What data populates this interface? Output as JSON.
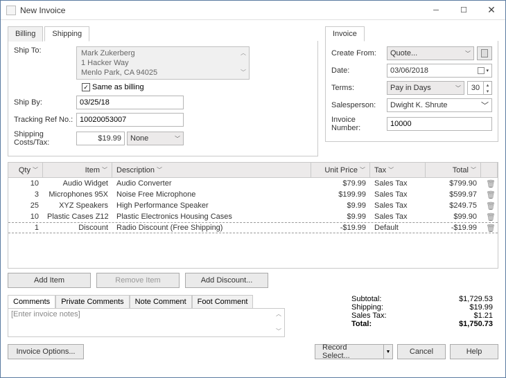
{
  "title": "New Invoice",
  "left_panel": {
    "tabs": {
      "billing": "Billing",
      "shipping": "Shipping"
    },
    "ship_to_label": "Ship To:",
    "address": {
      "line1": "Mark Zukerberg",
      "line2": "1 Hacker Way",
      "line3": "Menlo Park, CA 94025"
    },
    "same_as_billing": {
      "label": "Same as billing",
      "checked": true
    },
    "ship_by": {
      "label": "Ship By:",
      "value": "03/25/18"
    },
    "tracking": {
      "label": "Tracking Ref No.:",
      "value": "10020053007"
    },
    "shipping_cost": {
      "label": "Shipping Costs/Tax:",
      "value": "$19.99",
      "tax_select": "None"
    }
  },
  "right_panel": {
    "tab": "Invoice",
    "create_from": {
      "label": "Create From:",
      "value": "Quote..."
    },
    "date": {
      "label": "Date:",
      "value": "03/06/2018"
    },
    "terms": {
      "label": "Terms:",
      "value": "Pay in Days",
      "days": "30"
    },
    "salesperson": {
      "label": "Salesperson:",
      "value": "Dwight K. Shrute"
    },
    "invoice_number": {
      "label": "Invoice Number:",
      "value": "10000"
    }
  },
  "grid": {
    "headers": {
      "qty": "Qty",
      "item": "Item",
      "desc": "Description",
      "price": "Unit Price",
      "tax": "Tax",
      "total": "Total"
    },
    "rows": [
      {
        "qty": "10",
        "item": "Audio Widget",
        "desc": "Audio Converter",
        "price": "$79.99",
        "tax": "Sales Tax",
        "total": "$799.90"
      },
      {
        "qty": "3",
        "item": "Microphones 95X",
        "desc": "Noise Free Microphone",
        "price": "$199.99",
        "tax": "Sales Tax",
        "total": "$599.97"
      },
      {
        "qty": "25",
        "item": "XYZ Speakers",
        "desc": "High Performance Speaker",
        "price": "$9.99",
        "tax": "Sales Tax",
        "total": "$249.75"
      },
      {
        "qty": "10",
        "item": "Plastic Cases Z12",
        "desc": "Plastic Electronics Housing Cases",
        "price": "$9.99",
        "tax": "Sales Tax",
        "total": "$99.90"
      },
      {
        "qty": "1",
        "item": "Discount",
        "desc": "Radio Discount (Free Shipping)",
        "price": "-$19.99",
        "tax": "Default",
        "total": "-$19.99"
      }
    ]
  },
  "actions": {
    "add_item": "Add Item",
    "remove_item": "Remove Item",
    "add_discount": "Add Discount..."
  },
  "comment_tabs": {
    "comments": "Comments",
    "private": "Private Comments",
    "note": "Note Comment",
    "foot": "Foot Comment"
  },
  "comment_placeholder": "[Enter invoice notes]",
  "totals": {
    "subtotal": {
      "label": "Subtotal:",
      "value": "$1,729.53"
    },
    "shipping": {
      "label": "Shipping:",
      "value": "$19.99"
    },
    "sales_tax": {
      "label": "Sales Tax:",
      "value": "$1.21"
    },
    "total": {
      "label": "Total:",
      "value": "$1,750.73"
    }
  },
  "footer": {
    "invoice_options": "Invoice Options...",
    "record_select": "Record Select...",
    "cancel": "Cancel",
    "help": "Help"
  }
}
